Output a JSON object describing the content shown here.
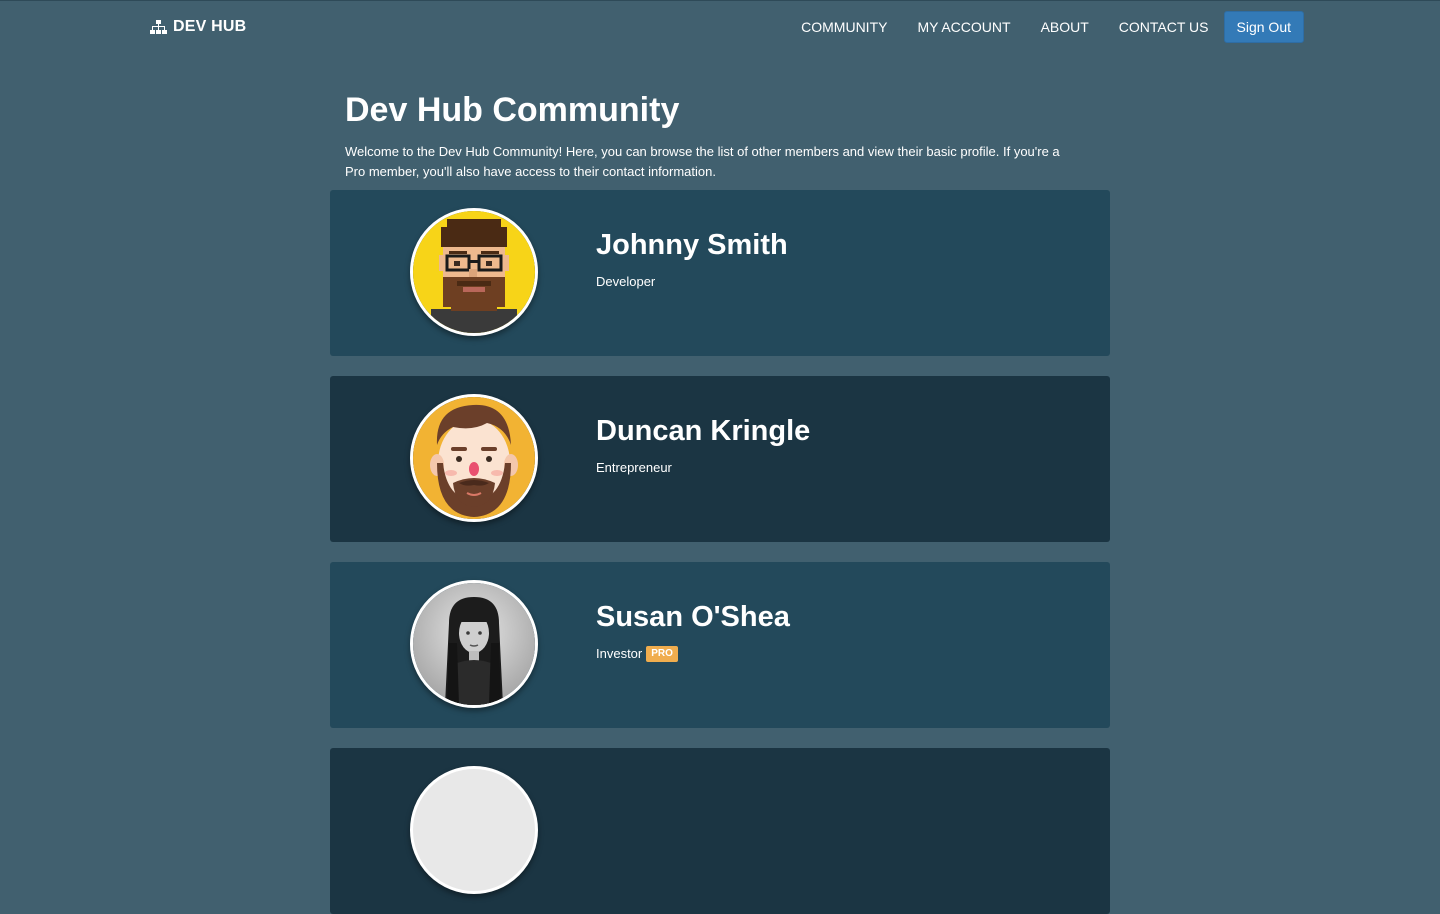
{
  "brand": {
    "name": "DEV HUB",
    "icon": "sitemap-icon"
  },
  "nav": {
    "links": [
      "COMMUNITY",
      "MY ACCOUNT",
      "ABOUT",
      "CONTACT US"
    ],
    "signout_label": "Sign Out",
    "signout_color": "#337ab7"
  },
  "page": {
    "title": "Dev Hub Community",
    "intro": "Welcome to the Dev Hub Community! Here, you can browse the list of other members and view their basic profile. If you're a Pro member, you'll also have access to their contact information."
  },
  "members": [
    {
      "name": "Johnny Smith",
      "role": "Developer",
      "avatar": "pixel-art-bearded-man-avatar"
    },
    {
      "name": "Duncan Kringle",
      "role": "Entrepreneur",
      "avatar": "cartoon-bearded-man-avatar"
    },
    {
      "name": "Susan O'Shea",
      "role": "Investor",
      "badge": "PRO",
      "avatar": "grayscale-woman-photo-avatar"
    }
  ],
  "colors": {
    "background": "#41606f",
    "card": "#23495b",
    "card_alt": "#1b3543",
    "badge": "#f0ad4e"
  }
}
